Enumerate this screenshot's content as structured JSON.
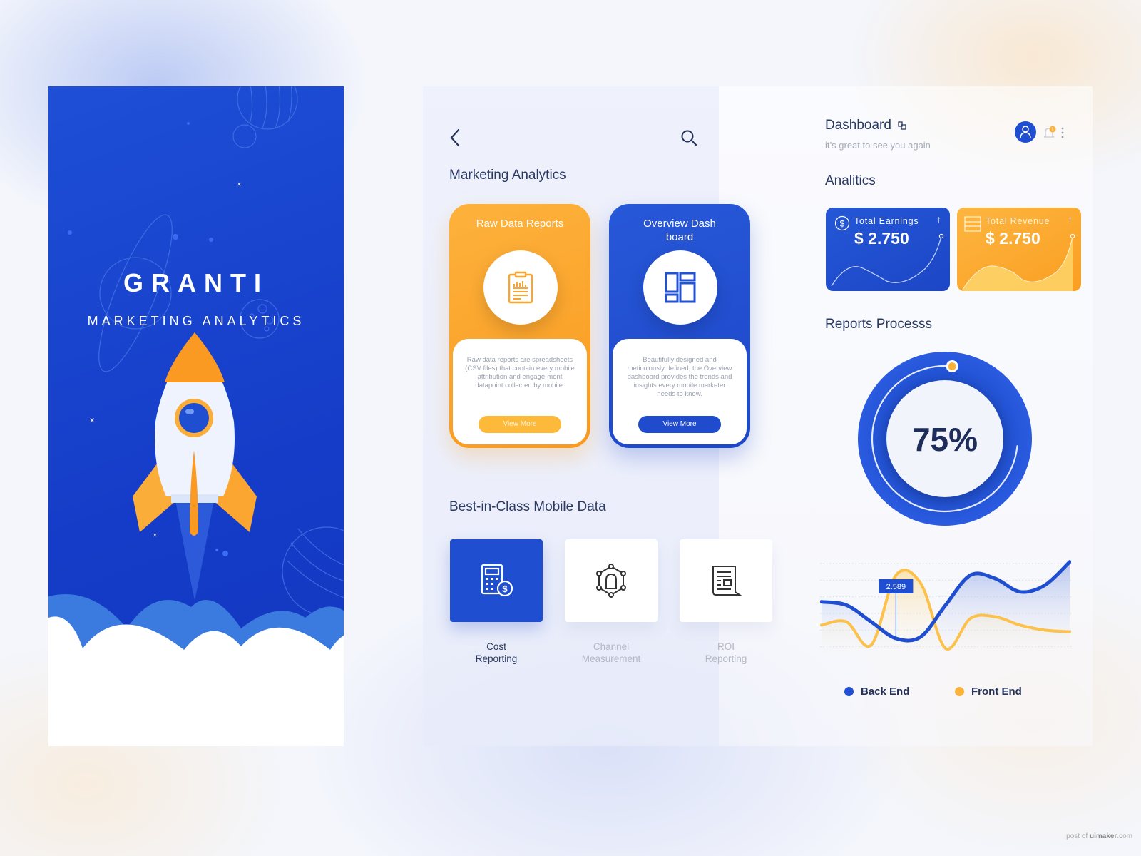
{
  "splash": {
    "brand": "GRANTI",
    "tagline": "MARKETING ANALYTICS"
  },
  "marketing": {
    "back_icon": "chevron-left-icon",
    "search_icon": "search-icon",
    "title": "Marketing Analytics",
    "cards": [
      {
        "title": "Raw Data Reports",
        "icon": "clipboard-chart-icon",
        "description": "Raw data reports are spreadsheets (CSV files) that contain every mobile attribution and engage-ment datapoint collected by mobile.",
        "button": "View More",
        "color": "#fba52e"
      },
      {
        "title": "Overview Dash board",
        "icon": "dashboard-layout-icon",
        "description": "Beautifully designed and meticulously defined, the Overview dashboard provides the trends and insights every mobile marketer needs to know.",
        "button": "View More",
        "color": "#2152d3"
      }
    ],
    "section2_title": "Best-in-Class Mobile Data",
    "tiles": [
      {
        "label_line1": "Cost",
        "label_line2": "Reporting",
        "icon": "calculator-dollar-icon",
        "active": true
      },
      {
        "label_line1": "Channel",
        "label_line2": "Measurement",
        "icon": "network-lock-icon",
        "active": false
      },
      {
        "label_line1": "ROI",
        "label_line2": "Reporting",
        "icon": "report-document-icon",
        "active": false
      }
    ]
  },
  "dashboard": {
    "title": "Dashboard",
    "subtitle": "it’s great to see you again",
    "notification_count": "1",
    "section_title": "Analitics",
    "stats": [
      {
        "label": "Total Earnings",
        "value": "$ 2.750",
        "icon": "dollar-circle-icon",
        "trend": "↑"
      },
      {
        "label": "Total Revenue",
        "value": "$ 2.750",
        "icon": "table-icon",
        "trend": "↑"
      }
    ],
    "reports_title": "Reports Processs",
    "progress": {
      "value": 75,
      "label": "75%"
    },
    "accent_blue": "#1f4fd0",
    "accent_orange": "#fbb33a"
  },
  "chart_data": {
    "type": "line",
    "title": "",
    "xlabel": "",
    "ylabel": "",
    "grid": true,
    "legend": "bottom",
    "x": [
      0,
      1,
      2,
      3,
      4,
      5,
      6,
      7,
      8,
      9,
      10
    ],
    "ylim": [
      0,
      6
    ],
    "series": [
      {
        "name": "Back End",
        "color": "#1f4fd0",
        "values": [
          3.4,
          3.2,
          2.2,
          1.2,
          1.3,
          3.2,
          5.0,
          4.8,
          4.0,
          4.4,
          5.8
        ]
      },
      {
        "name": "Front End",
        "color": "#fbb33a",
        "values": [
          2.0,
          2.2,
          0.8,
          5.0,
          4.5,
          0.6,
          2.4,
          2.5,
          2.0,
          1.7,
          1.6
        ]
      }
    ],
    "annotation": {
      "label": "2.589",
      "series": "Back End",
      "x": 3
    }
  },
  "footer": {
    "watermark_prefix": "post of ",
    "watermark_site": "uimaker",
    "watermark_suffix": ".com"
  }
}
